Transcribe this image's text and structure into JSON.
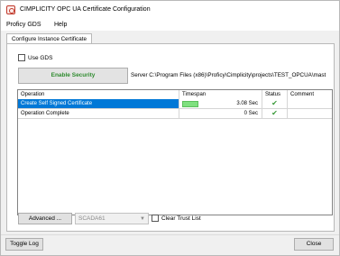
{
  "window": {
    "title": "CIMPLICITY OPC UA Certificate Configuration"
  },
  "menu": {
    "items": [
      {
        "label": "Proficy GDS"
      },
      {
        "label": "Help"
      }
    ]
  },
  "tabs": [
    {
      "label": "Configure Instance Certificate",
      "active": true
    }
  ],
  "panel": {
    "use_gds_label": "Use GDS",
    "use_gds_checked": false,
    "enable_security_label": "Enable Security",
    "server_text": "Server C:\\Program Files (x86)\\Proficy\\Cimplicity\\projects\\TEST_OPCUA\\mast"
  },
  "grid": {
    "columns": [
      "Operation",
      "Timespan",
      "Status",
      "Comment"
    ],
    "rows": [
      {
        "operation": "Create Self Signed Certificate",
        "timespan": "3.08 Sec",
        "status": "check-icon",
        "comment": "",
        "selected": true,
        "progress": 1.0
      },
      {
        "operation": "Operation Complete",
        "timespan": "0 Sec",
        "status": "check-icon",
        "comment": "",
        "selected": false
      }
    ]
  },
  "bottom": {
    "advanced_label": "Advanced ...",
    "scada_value": "SCADA61",
    "clear_trust_label": "Clear Trust List",
    "clear_trust_checked": false
  },
  "footer": {
    "toggle_log_label": "Toggle Log",
    "close_label": "Close"
  },
  "colors": {
    "selection": "#0078d7",
    "enable_security_text": "#2e8b2e",
    "progress_fill": "#7fe07f",
    "check": "#3a9a3a"
  }
}
